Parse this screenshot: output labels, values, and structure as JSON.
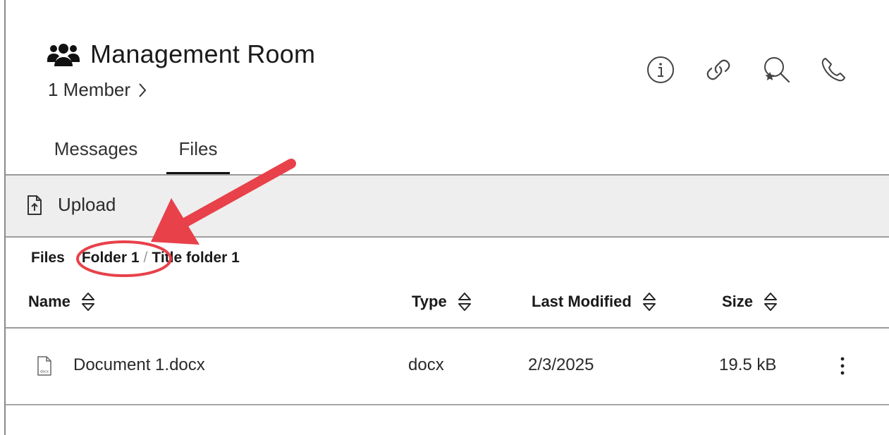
{
  "room": {
    "title": "Management Room",
    "members_label": "1 Member"
  },
  "header_actions": [
    {
      "name": "info",
      "icon": "info-icon"
    },
    {
      "name": "link",
      "icon": "link-icon"
    },
    {
      "name": "search-starred",
      "icon": "search-star-icon"
    },
    {
      "name": "call",
      "icon": "phone-icon"
    }
  ],
  "tabs": [
    {
      "label": "Messages",
      "active": false
    },
    {
      "label": "Files",
      "active": true
    }
  ],
  "toolbar": {
    "upload_label": "Upload",
    "upload_icon": "upload-file-icon"
  },
  "breadcrumb": [
    {
      "label": "Files"
    },
    {
      "label": "Folder 1"
    },
    {
      "label": "Title folder 1"
    }
  ],
  "table": {
    "columns": [
      "Name",
      "Type",
      "Last Modified",
      "Size"
    ],
    "rows": [
      {
        "name": "Document 1.docx",
        "type": "docx",
        "modified": "2/3/2025",
        "size": "19.5 kB",
        "icon": "docx-file-icon"
      }
    ]
  },
  "annotation": {
    "arrow_color": "#e8414a",
    "highlight": "Folder 1"
  },
  "colors": {
    "toolbar_bg": "#eeeeee",
    "active_tab_underline": "#111111",
    "annotation_red": "#e8414a"
  }
}
